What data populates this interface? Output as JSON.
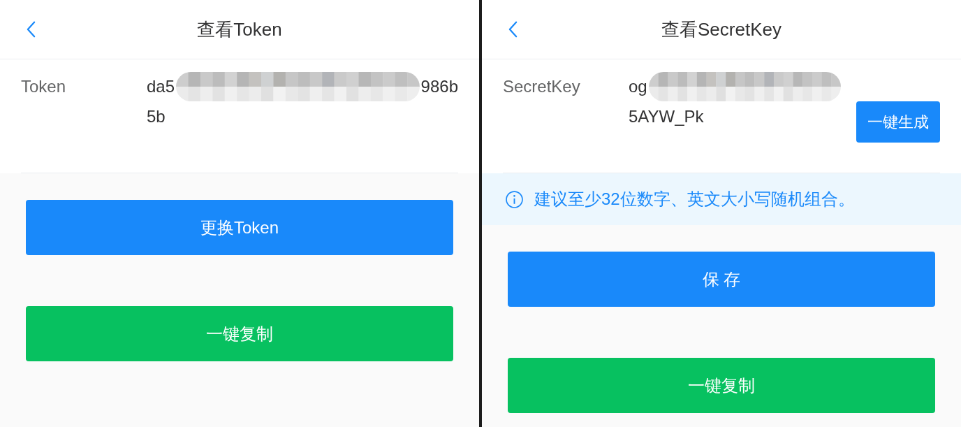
{
  "screens": [
    {
      "header": {
        "title": "查看Token"
      },
      "field": {
        "label": "Token",
        "value_lines": [
          {
            "text": "da5",
            "redacted": true,
            "after": "986b"
          },
          {
            "text": "5b",
            "redacted": false
          }
        ]
      },
      "buttons": [
        {
          "label": "更换Token",
          "kind": "primary"
        },
        {
          "label": "一键复制",
          "kind": "success"
        }
      ]
    },
    {
      "header": {
        "title": "查看SecretKey"
      },
      "field": {
        "label": "SecretKey",
        "value_lines": [
          {
            "text": "og",
            "redacted": true
          },
          {
            "text": "5AYW_Pk",
            "redacted": false
          }
        ],
        "action": "一键生成"
      },
      "notice": {
        "text": "建议至少32位数字、英文大小写随机组合。"
      },
      "buttons": [
        {
          "label": "保 存",
          "kind": "primary"
        },
        {
          "label": "一键复制",
          "kind": "success"
        }
      ]
    }
  ]
}
